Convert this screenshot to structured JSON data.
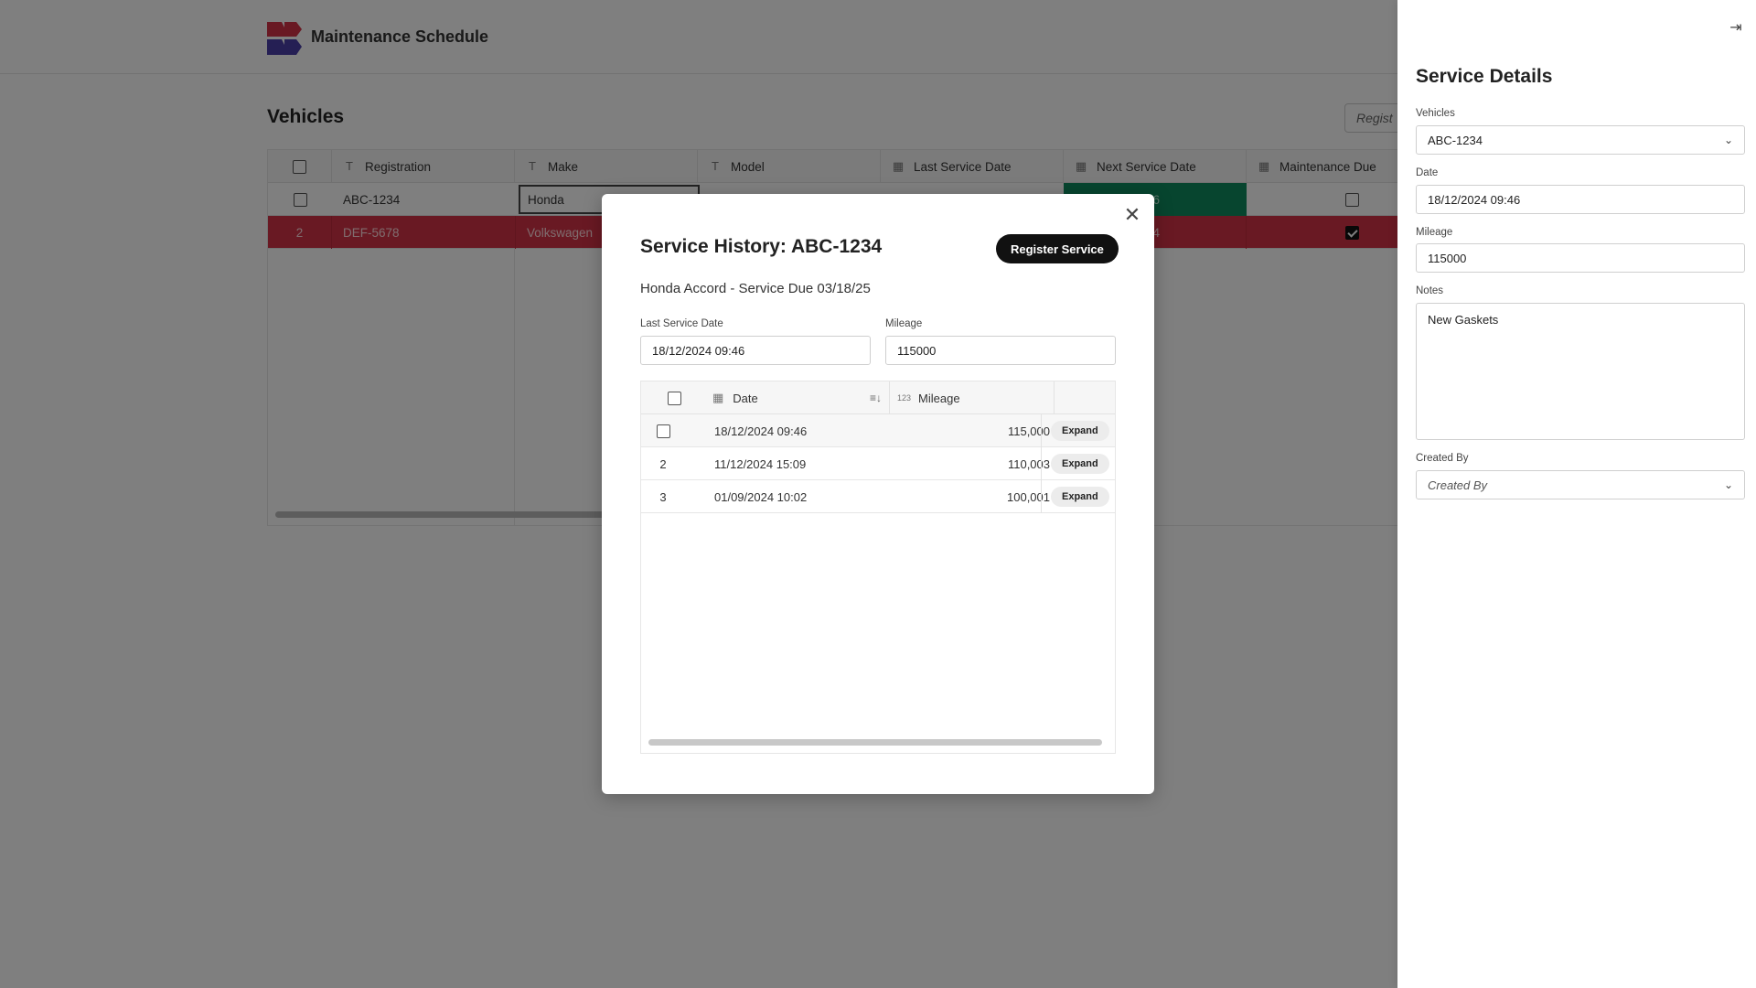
{
  "app": {
    "title": "Maintenance Schedule",
    "section_title": "Vehicles",
    "register_button_partial": "Regist"
  },
  "vehicles_grid": {
    "columns": [
      "Registration",
      "Make",
      "Model",
      "Last Service Date",
      "Next Service Date",
      "Maintenance Due"
    ],
    "rows": [
      {
        "index": "",
        "registration": "ABC-1234",
        "make": "Honda",
        "maintenance_due": false
      },
      {
        "index": "2",
        "registration": "DEF-5678",
        "make": "Volkswagen",
        "next_service_partial": "54",
        "maintenance_due": true
      }
    ],
    "row1_next_service_partial": "46"
  },
  "modal": {
    "title": "Service History: ABC-1234",
    "primary_button": "Register Service",
    "subtitle": "Honda Accord  - Service Due 03/18/25",
    "last_service_label": "Last Service Date",
    "last_service_value": "18/12/2024 09:46",
    "mileage_label": "Mileage",
    "mileage_value": "115000",
    "history": {
      "columns": [
        "Date",
        "Mileage"
      ],
      "mileage_icon_text": "123",
      "expand_label": "Expand",
      "rows": [
        {
          "index": "",
          "date": "18/12/2024 09:46",
          "mileage": "115,000"
        },
        {
          "index": "2",
          "date": "11/12/2024 15:09",
          "mileage": "110,003"
        },
        {
          "index": "3",
          "date": "01/09/2024 10:02",
          "mileage": "100,001"
        }
      ]
    }
  },
  "panel": {
    "title": "Service Details",
    "vehicles_label": "Vehicles",
    "vehicles_value": "ABC-1234",
    "date_label": "Date",
    "date_value": "18/12/2024 09:46",
    "mileage_label": "Mileage",
    "mileage_value": "115000",
    "notes_label": "Notes",
    "notes_value": "New Gaskets",
    "created_by_label": "Created By",
    "created_by_placeholder": "Created By"
  },
  "colors": {
    "danger_row": "#d23246",
    "next_service_green": "#0f8a5f",
    "primary_button": "#111111"
  },
  "icons": [
    "text-type-icon",
    "calendar-icon",
    "sort-icon",
    "close-icon",
    "chevron-down-icon",
    "collapse-panel-icon"
  ]
}
